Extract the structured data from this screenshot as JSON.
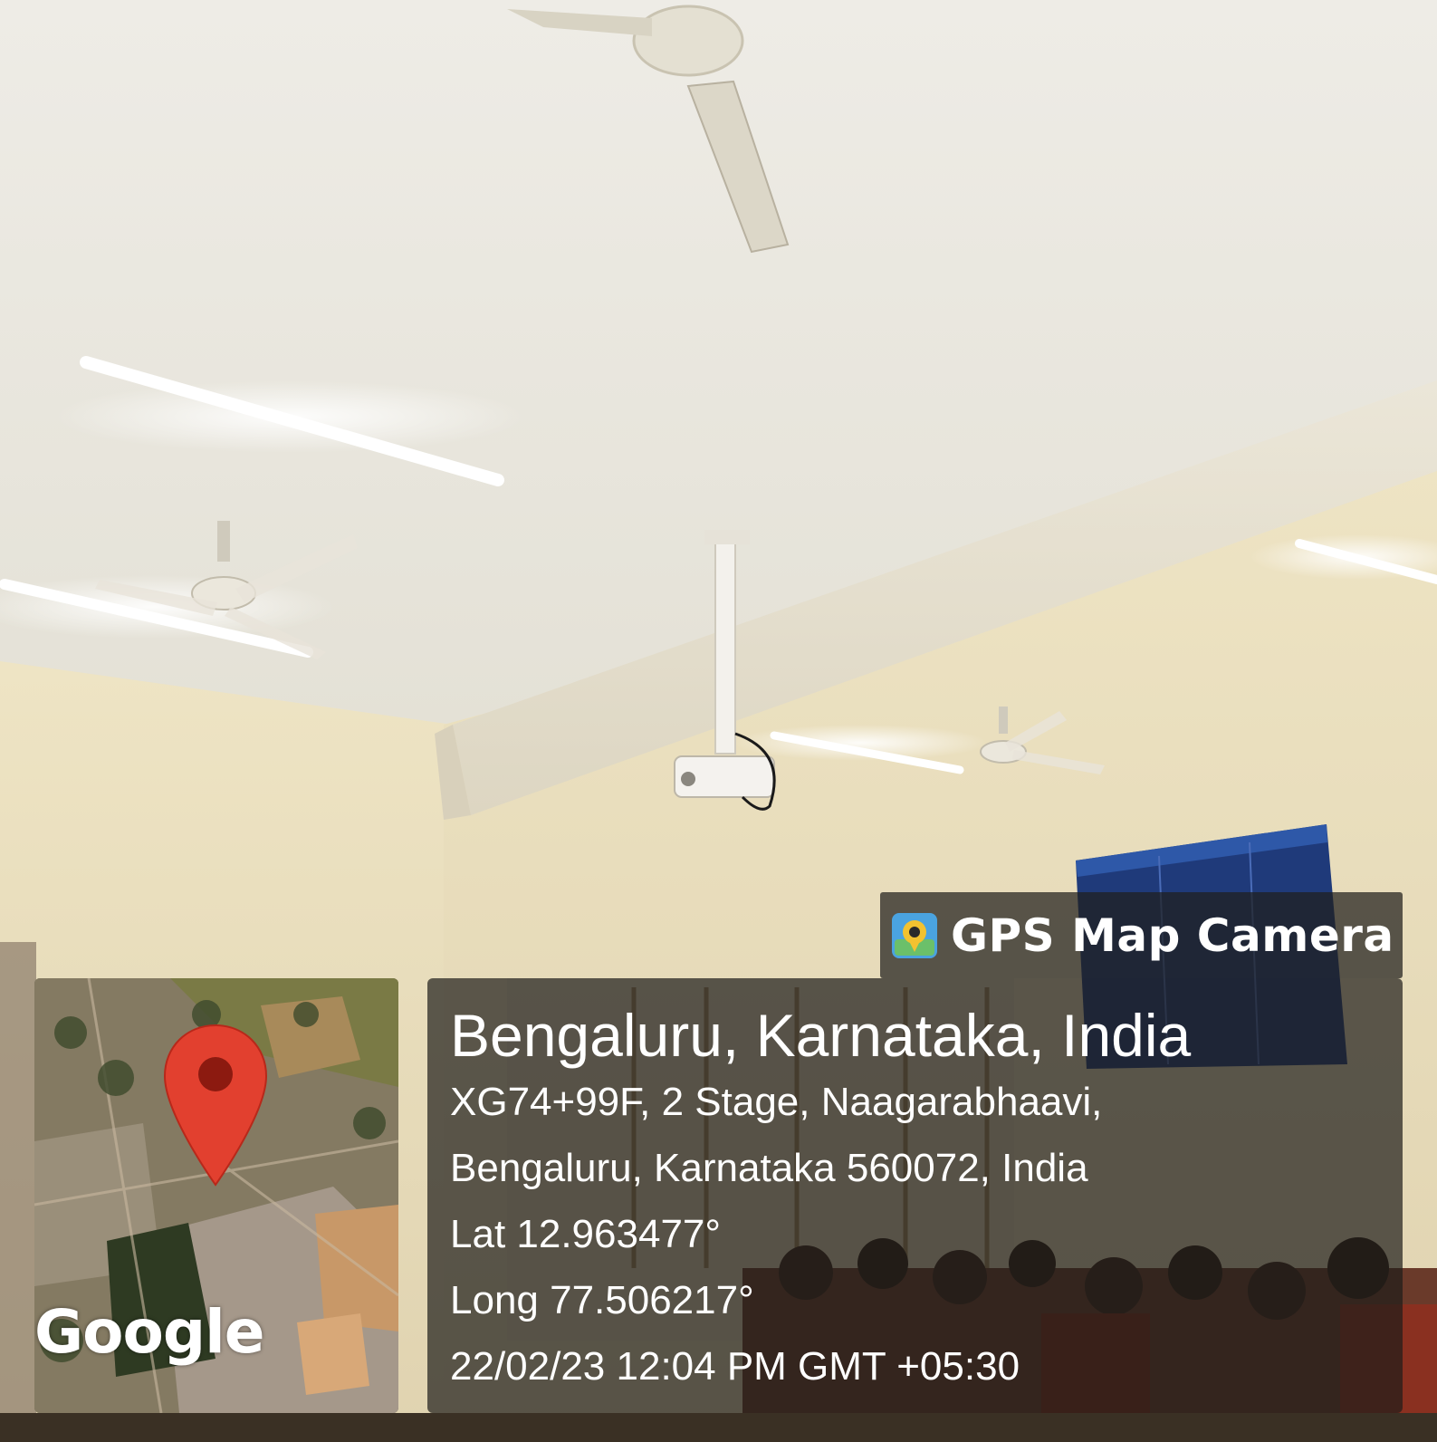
{
  "watermark": {
    "app_name": "GPS Map Camera",
    "icon": "gps-map-camera-app-icon"
  },
  "map": {
    "brand": "Google",
    "pin_icon": "map-pin-icon"
  },
  "location": {
    "title": "Bengaluru, Karnataka, India",
    "address_line1": "XG74+99F, 2 Stage, Naagarabhaavi,",
    "address_line2": "Bengaluru, Karnataka 560072, India",
    "latitude": "Lat 12.963477°",
    "longitude": "Long 77.506217°",
    "datetime": "22/02/23 12:04 PM GMT +05:30"
  },
  "colors": {
    "pin": "#e2402f",
    "overlay": "#1e1c1a"
  }
}
